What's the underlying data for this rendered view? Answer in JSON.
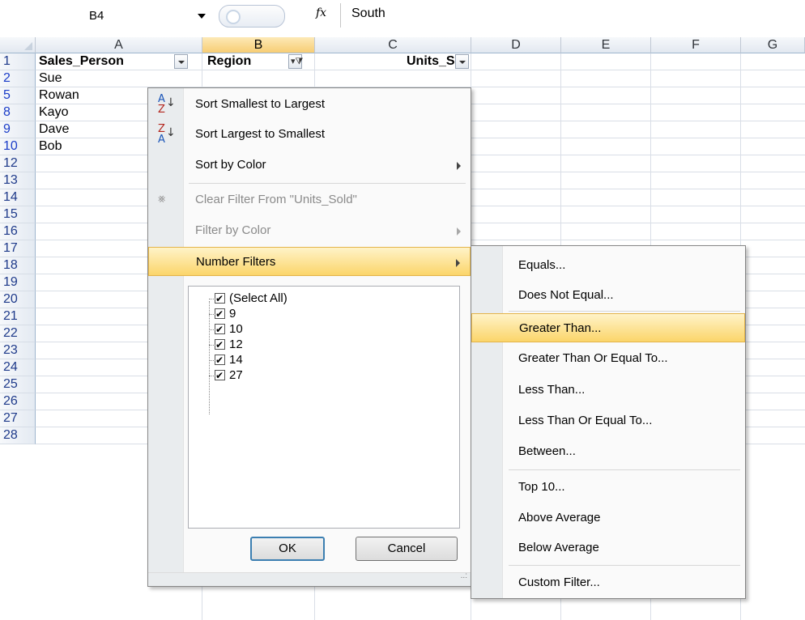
{
  "formula_bar": {
    "name_box": "B4",
    "fx_label": "fx",
    "value": "South"
  },
  "sheet": {
    "columns": [
      "A",
      "B",
      "C",
      "D",
      "E",
      "F",
      "G"
    ],
    "selected_column": "B",
    "row_numbers": [
      "1",
      "2",
      "5",
      "8",
      "9",
      "10",
      "12",
      "13",
      "14",
      "15",
      "16",
      "17",
      "18",
      "19",
      "20",
      "21",
      "22",
      "23",
      "24",
      "25",
      "26",
      "27",
      "28"
    ],
    "header_row": {
      "a": "Sales_Person",
      "b": "Region",
      "c": "Units_Sc"
    },
    "names": [
      "Sue",
      "Rowan",
      "Kayo",
      "Dave",
      "Bob"
    ]
  },
  "filter_menu": {
    "items": [
      {
        "label": "Sort Smallest to Largest",
        "icon": "sort-ascending-icon"
      },
      {
        "label": "Sort Largest to Smallest",
        "icon": "sort-descending-icon"
      },
      {
        "label": "Sort by Color",
        "icon": ""
      },
      {
        "label": "Clear Filter From \"Units_Sold\"",
        "icon": "clear-filter-icon"
      },
      {
        "label": "Filter by Color",
        "icon": ""
      },
      {
        "label": "Number Filters",
        "icon": ""
      }
    ],
    "checklist": [
      "(Select All)",
      "9",
      "10",
      "12",
      "14",
      "27"
    ],
    "ok_label": "OK",
    "cancel_label": "Cancel"
  },
  "number_filters_submenu": {
    "items": [
      "Equals...",
      "Does Not Equal...",
      "Greater Than...",
      "Greater Than Or Equal To...",
      "Less Than...",
      "Less Than Or Equal To...",
      "Between...",
      "Top 10...",
      "Above Average",
      "Below Average",
      "Custom Filter..."
    ],
    "highlighted": "Greater Than..."
  },
  "colors": {
    "highlight": "#fbd56a",
    "row_header_text": "#1a3cc8",
    "menu_border": "#868686"
  }
}
